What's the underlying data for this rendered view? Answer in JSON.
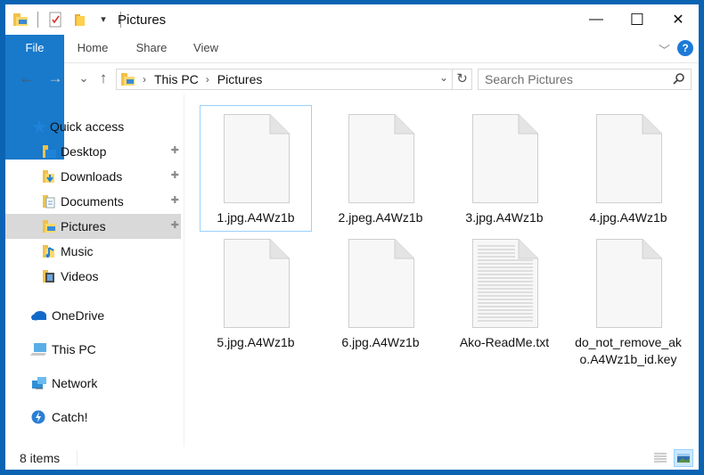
{
  "window": {
    "title": "Pictures",
    "controls": {
      "minimize": "—",
      "maximize": "☐",
      "close": "✕"
    }
  },
  "ribbon": {
    "tabs": [
      {
        "label": "File",
        "active": true
      },
      {
        "label": "Home"
      },
      {
        "label": "Share"
      },
      {
        "label": "View"
      }
    ],
    "expand_icon": "﹀",
    "help_label": "?"
  },
  "nav": {
    "back": "←",
    "forward": "→",
    "recent": "⌄",
    "up": "↑",
    "breadcrumb": [
      "This PC",
      "Pictures"
    ],
    "breadcrumb_sep": "›",
    "dropdown": "⌄",
    "refresh": "↻",
    "search_placeholder": "Search Pictures",
    "search_icon": "⚲"
  },
  "sidebar": {
    "quick_access": {
      "label": "Quick access",
      "icon": "star-icon"
    },
    "items": [
      {
        "label": "Desktop",
        "icon": "desktop-folder-icon",
        "pinned": true
      },
      {
        "label": "Downloads",
        "icon": "downloads-folder-icon",
        "pinned": true
      },
      {
        "label": "Documents",
        "icon": "documents-folder-icon",
        "pinned": true
      },
      {
        "label": "Pictures",
        "icon": "pictures-folder-icon",
        "pinned": true,
        "selected": true
      },
      {
        "label": "Music",
        "icon": "music-folder-icon",
        "pinned": false
      },
      {
        "label": "Videos",
        "icon": "videos-folder-icon",
        "pinned": false
      }
    ],
    "locations": [
      {
        "label": "OneDrive",
        "icon": "onedrive-icon"
      },
      {
        "label": "This PC",
        "icon": "this-pc-icon"
      },
      {
        "label": "Network",
        "icon": "network-icon"
      },
      {
        "label": "Catch!",
        "icon": "catch-icon"
      }
    ],
    "pin_glyph": "📌"
  },
  "files": [
    {
      "name": "1.jpg.A4Wz1b",
      "type": "blank",
      "focused": true
    },
    {
      "name": "2.jpeg.A4Wz1b",
      "type": "blank"
    },
    {
      "name": "3.jpg.A4Wz1b",
      "type": "blank"
    },
    {
      "name": "4.jpg.A4Wz1b",
      "type": "blank"
    },
    {
      "name": "5.jpg.A4Wz1b",
      "type": "blank"
    },
    {
      "name": "6.jpg.A4Wz1b",
      "type": "blank"
    },
    {
      "name": "Ako-ReadMe.txt",
      "type": "text"
    },
    {
      "name": "do_not_remove_ako.A4Wz1b_id.key",
      "type": "blank"
    }
  ],
  "status": {
    "item_count": "8 items"
  },
  "colors": {
    "accent": "#1979ca",
    "frame": "#0b63b3",
    "selection": "#d9d9d9",
    "focus_outline": "#99d1ff"
  }
}
